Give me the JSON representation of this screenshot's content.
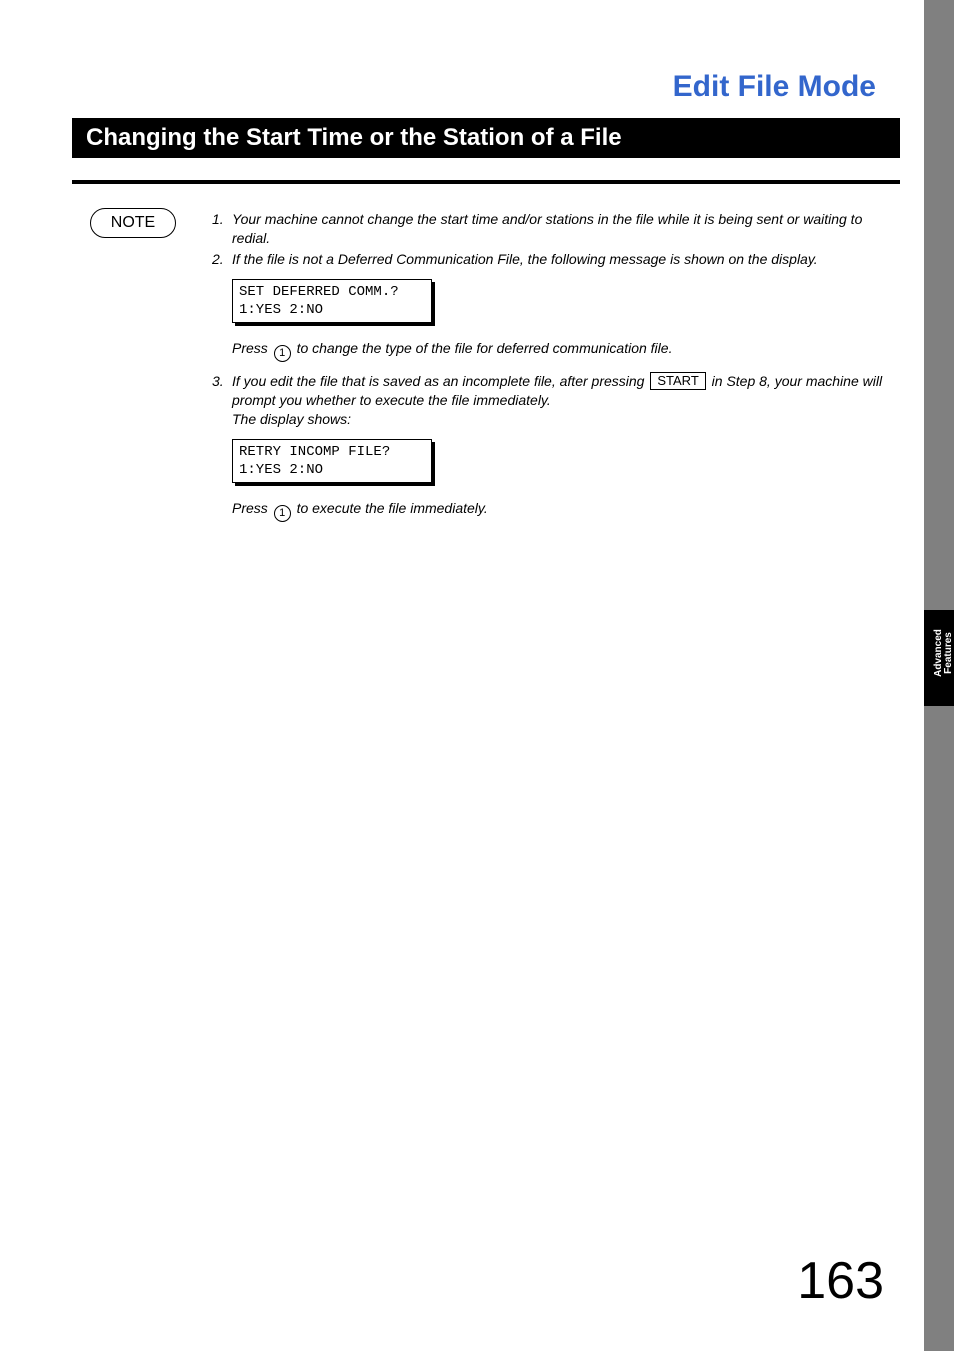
{
  "chapter_title": "Edit File Mode",
  "section_title": "Changing the Start Time or the Station of a File",
  "note_label": "NOTE",
  "notes": {
    "n1_num": "1.",
    "n1_text": "Your machine cannot change the start time and/or stations in the file while it is being sent or waiting to redial.",
    "n2_num": "2.",
    "n2_text": "If the file is not a Deferred Communication File, the following message is shown on the display.",
    "lcd1_line1": "SET DEFERRED COMM.?",
    "lcd1_line2": "1:YES 2:NO",
    "press1_a": "Press ",
    "press1_key": "1",
    "press1_b": " to change the type of the file for deferred communication file.",
    "n3_num": "3.",
    "n3_a": "If you edit the file that is saved as an incomplete file, after pressing ",
    "n3_key": "START",
    "n3_b": " in Step 8, your machine will prompt you whether to execute the file immediately.",
    "n3_c": "The display shows:",
    "lcd2_line1": "RETRY INCOMP FILE?",
    "lcd2_line2": "1:YES 2:NO",
    "press2_a": "Press ",
    "press2_key": "1",
    "press2_b": " to execute the file immediately."
  },
  "side_tab_line1": "Advanced",
  "side_tab_line2": "Features",
  "page_number": "163"
}
